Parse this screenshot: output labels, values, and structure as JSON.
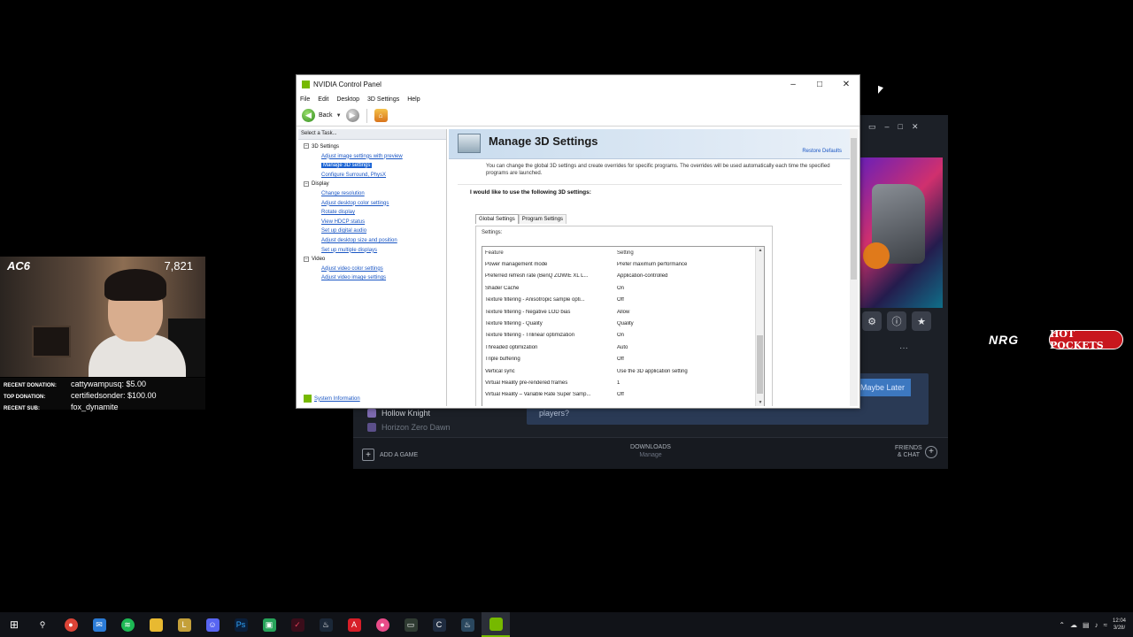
{
  "stream_overlay": {
    "logo": "AC6",
    "viewer_count": "7,821",
    "donations": [
      {
        "label": "RECENT DONATION:",
        "value": "cattywampusq: $5.00"
      },
      {
        "label": "TOP DONATION:",
        "value": "certifiedsonder: $100.00"
      },
      {
        "label": "RECENT SUB:",
        "value": "fox_dynamite"
      }
    ]
  },
  "sponsors": {
    "nrg": "NRG",
    "hotpockets": "HOT POCKETS"
  },
  "launcher": {
    "panel_text": "players?",
    "panel_button": "Maybe Later",
    "games": [
      "Hollow Knight",
      "Horizon Zero Dawn"
    ],
    "add_game": "ADD A GAME",
    "downloads_label": "DOWNLOADS",
    "downloads_sub": "Manage",
    "friends_label": "FRIENDS & CHAT",
    "more": "···"
  },
  "window": {
    "title": "NVIDIA Control Panel",
    "menu": [
      "File",
      "Edit",
      "Desktop",
      "3D Settings",
      "Help"
    ],
    "toolbar": {
      "back": "Back"
    },
    "task_header": "Select a Task...",
    "tree": [
      {
        "category": "3D Settings",
        "items": [
          "Adjust image settings with preview",
          "Manage 3D settings",
          "Configure Surround, PhysX"
        ]
      },
      {
        "category": "Display",
        "items": [
          "Change resolution",
          "Adjust desktop color settings",
          "Rotate display",
          "View HDCP status",
          "Set up digital audio",
          "Adjust desktop size and position",
          "Set up multiple displays"
        ]
      },
      {
        "category": "Video",
        "items": [
          "Adjust video color settings",
          "Adjust video image settings"
        ]
      }
    ],
    "selected_item": "Manage 3D settings",
    "system_info": "System Information",
    "page_title": "Manage 3D Settings",
    "restore_defaults": "Restore Defaults",
    "description": "You can change the global 3D settings and create overrides for specific programs. The overrides will be used automatically each time the specified programs are launched.",
    "prompt": "I would like to use the following 3D settings:",
    "tabs": [
      "Global Settings",
      "Program Settings"
    ],
    "settings_label": "Settings:",
    "columns": {
      "feature": "Feature",
      "setting": "Setting"
    },
    "settings": [
      {
        "feature": "Power management mode",
        "setting": "Prefer maximum performance"
      },
      {
        "feature": "Preferred refresh rate (BenQ ZOWIE XL L...",
        "setting": "Application-controlled"
      },
      {
        "feature": "Shader Cache",
        "setting": "On"
      },
      {
        "feature": "Texture filtering - Anisotropic sample opti...",
        "setting": "Off"
      },
      {
        "feature": "Texture filtering - Negative LOD bias",
        "setting": "Allow"
      },
      {
        "feature": "Texture filtering - Quality",
        "setting": "Quality"
      },
      {
        "feature": "Texture filtering - Trilinear optimization",
        "setting": "On"
      },
      {
        "feature": "Threaded optimization",
        "setting": "Auto"
      },
      {
        "feature": "Triple buffering",
        "setting": "Off"
      },
      {
        "feature": "Vertical sync",
        "setting": "Use the 3D application setting"
      },
      {
        "feature": "Virtual Reality pre-rendered frames",
        "setting": "1"
      },
      {
        "feature": "Virtual Reality – Variable Rate Super Samp...",
        "setting": "Off"
      }
    ]
  },
  "taskbar": {
    "clock_time": "12:04",
    "clock_date": "3/28/"
  }
}
